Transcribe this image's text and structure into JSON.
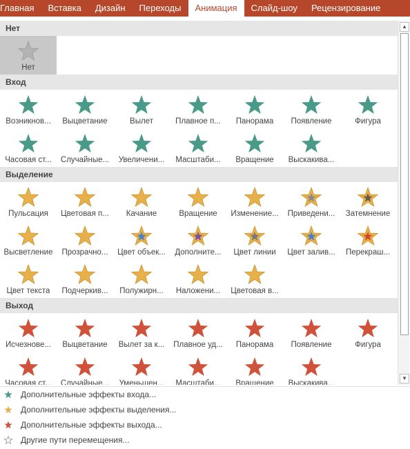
{
  "colors": {
    "ribbon": "#b7472a",
    "entrance": "#4a9a8a",
    "emphasis": "#e8b04a",
    "exit": "#d0523a",
    "none": "#b3b3b3"
  },
  "ribbon": {
    "tabs": [
      {
        "label": "Главная"
      },
      {
        "label": "Вставка"
      },
      {
        "label": "Дизайн"
      },
      {
        "label": "Переходы"
      },
      {
        "label": "Анимация",
        "active": true
      },
      {
        "label": "Слайд-шоу"
      },
      {
        "label": "Рецензирование"
      }
    ]
  },
  "gallery": {
    "none_section": {
      "title": "Нет",
      "items": [
        {
          "label": "Нет",
          "icon": "star-gray-icon"
        }
      ]
    },
    "entrance": {
      "title": "Вход",
      "rows": [
        [
          "Возникнов...",
          "Выцветание",
          "Вылет",
          "Плавное п...",
          "Панорама",
          "Появление",
          "Фигура"
        ],
        [
          "Часовая ст...",
          "Случайные...",
          "Увеличени...",
          "Масштаби...",
          "Вращение",
          "Выскакива..."
        ]
      ]
    },
    "emphasis": {
      "title": "Выделение",
      "rows": [
        [
          "Пульсация",
          "Цветовая п...",
          "Качание",
          "Вращение",
          "Изменение...",
          "Приведени...",
          "Затемнение"
        ],
        [
          "Высветление",
          "Прозрачно...",
          "Цвет объек...",
          "Дополните...",
          "Цвет линии",
          "Цвет залив...",
          "Перекраш..."
        ],
        [
          "Цвет текста",
          "Подчеркив...",
          "Полужирн...",
          "Наложени...",
          "Цветовая в..."
        ]
      ]
    },
    "exit": {
      "title": "Выход",
      "rows": [
        [
          "Исчезнове...",
          "Выцветание",
          "Вылет за к...",
          "Плавное уд...",
          "Панорама",
          "Появление",
          "Фигура"
        ],
        [
          "Часовая ст...",
          "Случайные...",
          "Уменьшен...",
          "Масштаби...",
          "Вращение",
          "Выскакива..."
        ]
      ]
    }
  },
  "menu": {
    "items": [
      {
        "label": "Дополнительные эффекты входа...",
        "icon": "star-green-icon"
      },
      {
        "label": "Дополнительные эффекты выделения...",
        "icon": "star-yellow-icon"
      },
      {
        "label": "Дополнительные эффекты выхода...",
        "icon": "star-red-icon"
      },
      {
        "label": "Другие пути перемещения...",
        "icon": "star-outline-icon"
      }
    ]
  }
}
